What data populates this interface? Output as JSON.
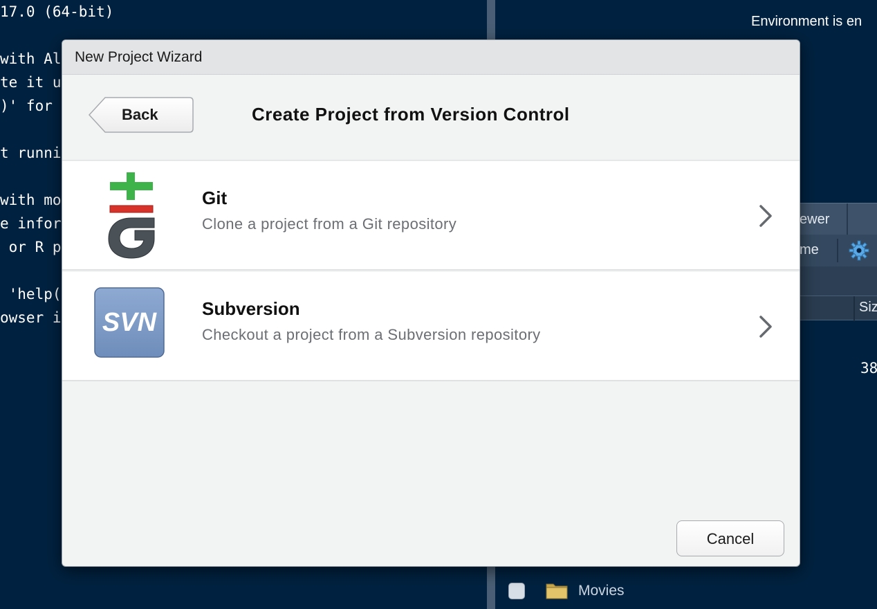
{
  "background": {
    "console_lines": [
      {
        "text": "17.0 (64-bit)"
      },
      {
        "text": "with Al"
      },
      {
        "text": "te it u"
      },
      {
        "text": ")' for"
      },
      {
        "text": "t runni"
      },
      {
        "text": "with mo"
      },
      {
        "text": "e infor"
      },
      {
        "text": " or R p"
      },
      {
        "text": " 'help("
      },
      {
        "text": "owser i"
      }
    ],
    "environment_text": "Environment is en",
    "viewer_tab_label": "ewer",
    "name_column_label": "me",
    "size_column_label": "Siz",
    "partial_number": "38",
    "files_row_label": "Movies"
  },
  "dialog": {
    "window_title": "New Project Wizard",
    "back_label": "Back",
    "page_title": "Create Project from Version Control",
    "options": [
      {
        "title": "Git",
        "description": "Clone a project from a Git repository",
        "icon": "git-icon"
      },
      {
        "title": "Subversion",
        "description": "Checkout a project from a Subversion repository",
        "icon": "svn-icon",
        "icon_text": "SVN"
      }
    ],
    "cancel_label": "Cancel"
  },
  "colors": {
    "ide_background": "#002240",
    "git_green": "#3db34a",
    "git_red": "#d8332b",
    "svn_blue": "#7f9cc6"
  }
}
